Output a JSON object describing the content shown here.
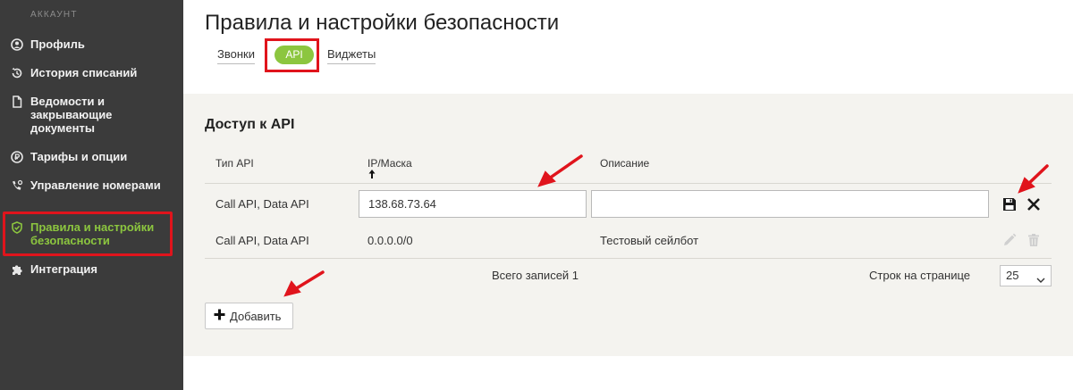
{
  "sidebar": {
    "header": "АККАУНТ",
    "items": [
      {
        "label": "Профиль",
        "icon": "user-circle-icon"
      },
      {
        "label": "История списаний",
        "icon": "history-icon"
      },
      {
        "label": "Ведомости и закрывающие документы",
        "icon": "document-icon"
      },
      {
        "label": "Тарифы и опции",
        "icon": "tariff-icon"
      },
      {
        "label": "Управление номерами",
        "icon": "phone-settings-icon"
      },
      {
        "label": "Правила и настройки безопасности",
        "icon": "shield-check-icon",
        "active": true
      },
      {
        "label": "Интеграция",
        "icon": "puzzle-icon"
      }
    ]
  },
  "page": {
    "title": "Правила и настройки безопасности"
  },
  "tabs": {
    "calls": "Звонки",
    "api": "API",
    "widgets": "Виджеты",
    "active": "api"
  },
  "section": {
    "title": "Доступ к API"
  },
  "table": {
    "columns": [
      "Тип API",
      "IP/Маска",
      "Описание"
    ],
    "sort_column": "IP/Маска",
    "edit_row": {
      "type": "Call API, Data API",
      "ip_value": "138.68.73.64",
      "description_value": ""
    },
    "rows": [
      {
        "type": "Call API, Data API",
        "ip": "0.0.0.0/0",
        "description": "Тестовый сейлбот"
      }
    ],
    "total_label": "Всего записей 1",
    "per_page_label": "Строк на странице",
    "per_page_value": "25"
  },
  "actions": {
    "add_label": "Добавить"
  },
  "colors": {
    "sidebar_bg": "#3b3b3b",
    "accent_green": "#8cc63f",
    "highlight_red": "#e0141c",
    "panel_bg": "#f4f3ef"
  }
}
